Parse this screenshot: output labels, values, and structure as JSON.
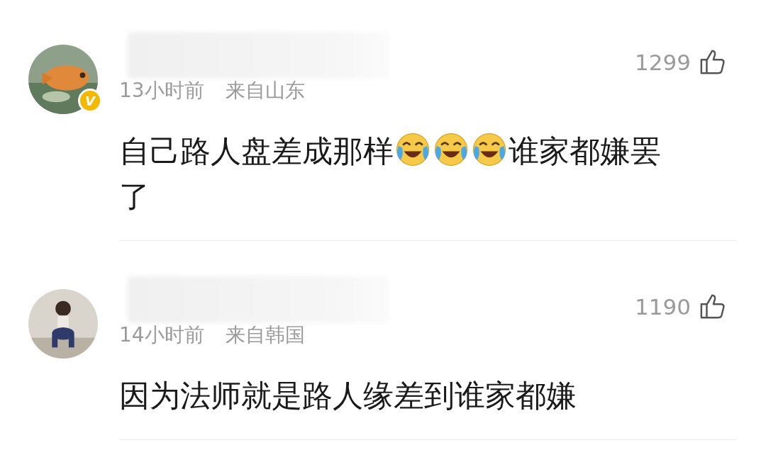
{
  "comments": [
    {
      "name_hidden": true,
      "verified_badge": "V",
      "likes": "1299",
      "time": "13小时前",
      "location": "来自山东",
      "avatar": {
        "kind": "picture"
      },
      "content": [
        {
          "kind": "text",
          "text": "自己路人盘差成那样"
        },
        {
          "kind": "emoji"
        },
        {
          "kind": "emoji"
        },
        {
          "kind": "emoji"
        },
        {
          "kind": "text",
          "text": "谁家都嫌罢了"
        }
      ]
    },
    {
      "name_hidden": true,
      "likes": "1190",
      "time": "14小时前",
      "location": "来自韩国",
      "avatar": {
        "kind": "picture"
      },
      "content": [
        {
          "kind": "text",
          "text": "因为法师就是路人缘差到谁家都嫌"
        }
      ]
    }
  ]
}
